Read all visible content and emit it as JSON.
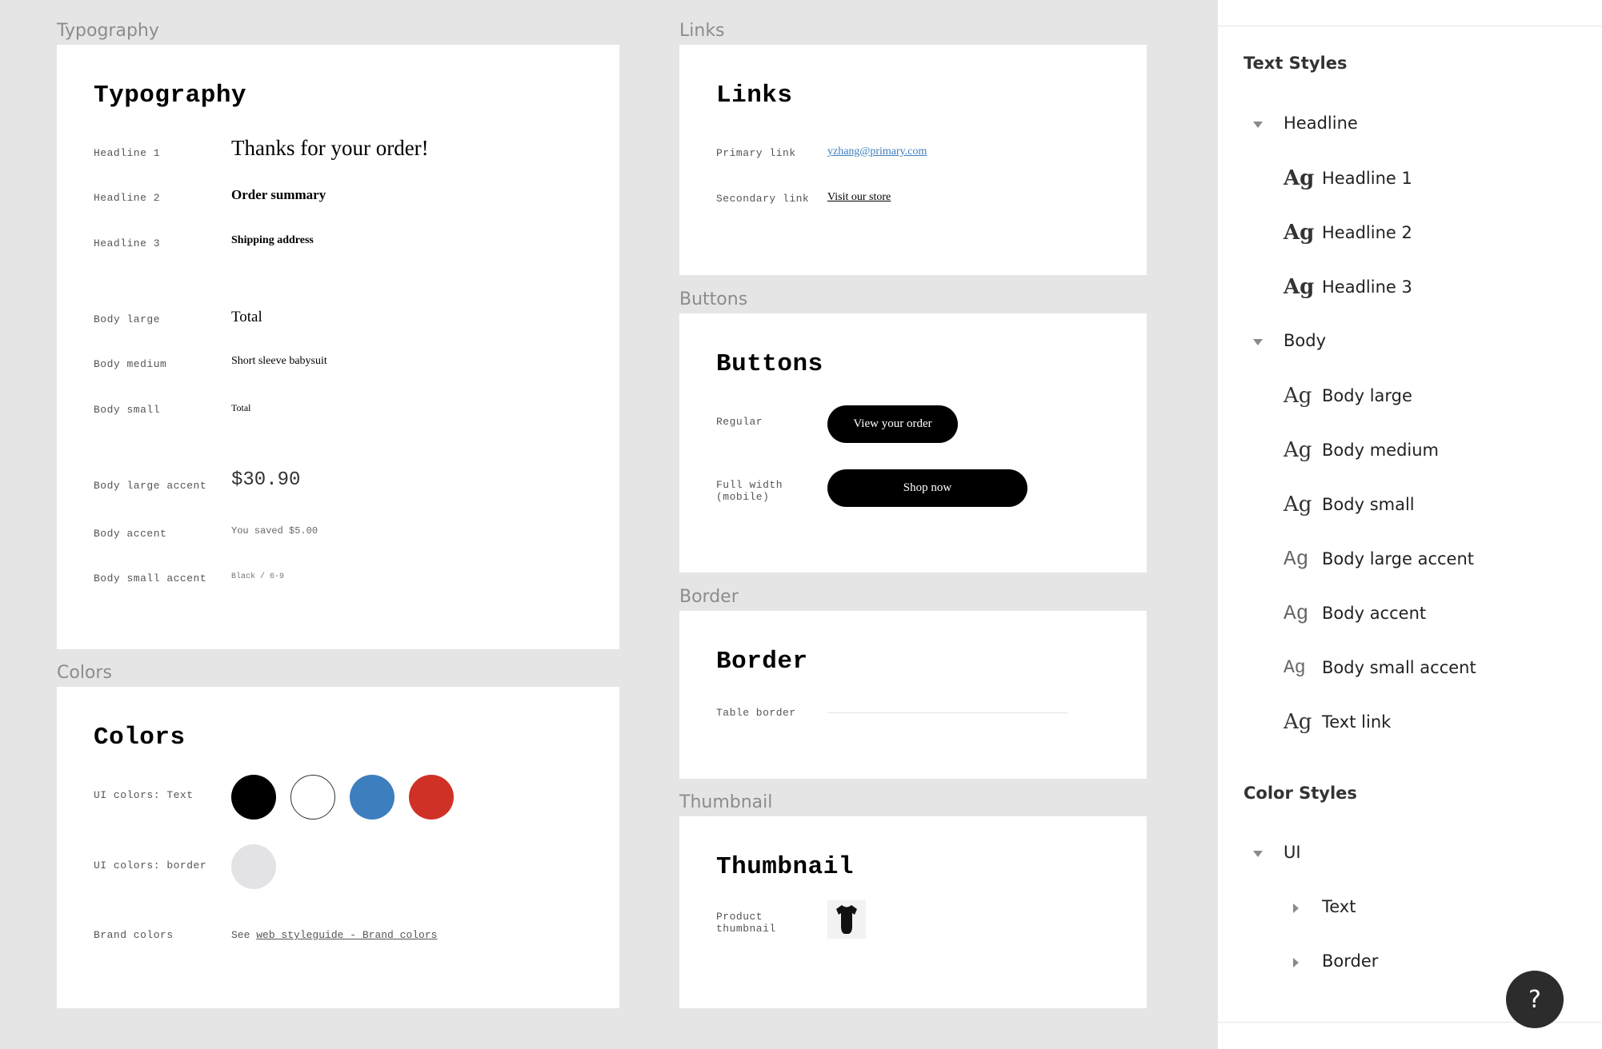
{
  "typography": {
    "frame_label": "Typography",
    "title": "Typography",
    "rows": [
      {
        "label": "Headline 1",
        "sample": "Thanks for your order!"
      },
      {
        "label": "Headline 2",
        "sample": "Order summary"
      },
      {
        "label": "Headline 3",
        "sample": "Shipping address"
      },
      {
        "label": "Body large",
        "sample": "Total"
      },
      {
        "label": "Body medium",
        "sample": "Short sleeve babysuit"
      },
      {
        "label": "Body small",
        "sample": "Total"
      },
      {
        "label": "Body large accent",
        "sample": "$30.90"
      },
      {
        "label": "Body accent",
        "sample": "You saved $5.00"
      },
      {
        "label": "Body small accent",
        "sample": "Black / 6-9"
      }
    ]
  },
  "colors": {
    "frame_label": "Colors",
    "title": "Colors",
    "text_label": "UI colors: Text",
    "text_swatches": [
      "#000000",
      "#ffffff",
      "#3d7ebf",
      "#d03127"
    ],
    "border_label": "UI colors: border",
    "border_swatches": [
      "#e3e3e5"
    ],
    "brand_label": "Brand colors",
    "brand_prefix": "See",
    "brand_link": "web styleguide - Brand colors"
  },
  "links": {
    "frame_label": "Links",
    "title": "Links",
    "primary_label": "Primary link",
    "primary_value": "yzhang@primary.com",
    "primary_color": "#3d7ebf",
    "secondary_label": "Secondary link",
    "secondary_value": "Visit our store"
  },
  "buttons": {
    "frame_label": "Buttons",
    "title": "Buttons",
    "regular_label": "Regular",
    "regular_button": "View your order",
    "full_label": "Full width (mobile)",
    "full_button": "Shop now"
  },
  "border": {
    "frame_label": "Border",
    "title": "Border",
    "table_label": "Table border"
  },
  "thumbnail": {
    "frame_label": "Thumbnail",
    "title": "Thumbnail",
    "product_label": "Product thumbnail",
    "icon": "babysuit-icon"
  },
  "panel": {
    "text_styles_title": "Text Styles",
    "headline_group": "Headline",
    "headline_styles": [
      "Headline 1",
      "Headline 2",
      "Headline 3"
    ],
    "body_group": "Body",
    "body_styles": [
      "Body large",
      "Body medium",
      "Body small",
      "Body large accent",
      "Body accent",
      "Body small accent",
      "Text link"
    ],
    "ag_glyph": "Ag",
    "color_styles_title": "Color Styles",
    "ui_group": "UI",
    "ui_children": [
      "Text",
      "Border"
    ],
    "help": "?"
  }
}
